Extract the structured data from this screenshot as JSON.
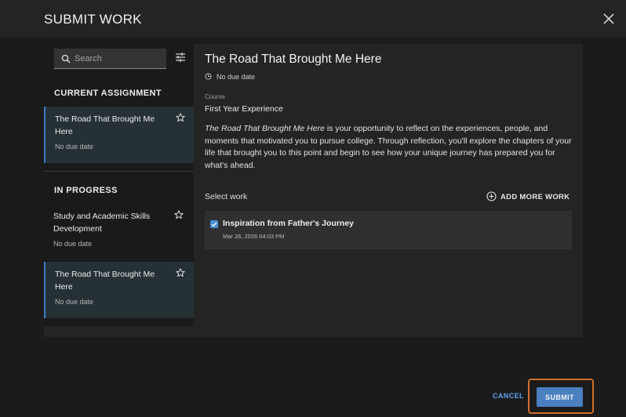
{
  "dialog": {
    "title": "SUBMIT WORK",
    "close_icon": "close-icon"
  },
  "sidebar": {
    "search_placeholder": "Search",
    "current_heading": "CURRENT ASSIGNMENT",
    "in_progress_heading": "IN PROGRESS",
    "current_items": [
      {
        "title": "The Road That Brought Me Here",
        "due": "No due date",
        "selected": true
      }
    ],
    "in_progress_items": [
      {
        "title": "Study and Academic Skills Development",
        "due": "No due date",
        "selected": false
      },
      {
        "title": "The Road That Brought Me Here",
        "due": "No due date",
        "selected": true
      }
    ]
  },
  "detail": {
    "title": "The Road That Brought Me Here",
    "due": "No due date",
    "course_label": "Course",
    "course_name": "First Year Experience",
    "description_italic": "The Road That Brought Me Here",
    "description_rest": " is your opportunity to reflect on the experiences, people, and moments that motivated you to pursue college. Through reflection, you'll explore the chapters of your life that brought you to this point and begin to see how your unique journey has prepared you for what's ahead.",
    "select_label": "Select work",
    "add_more_label": "ADD MORE WORK",
    "work_items": [
      {
        "title": "Inspiration from Father's Journey",
        "date": "Mar 26, 2026 04:03 PM",
        "checked": true
      }
    ]
  },
  "footer": {
    "cancel_label": "CANCEL",
    "submit_label": "SUBMIT"
  },
  "colors": {
    "accent": "#4a7fc0",
    "link": "#5ea2f0",
    "focus_outline": "#d0702a",
    "checkbox": "#4a8fd8"
  }
}
